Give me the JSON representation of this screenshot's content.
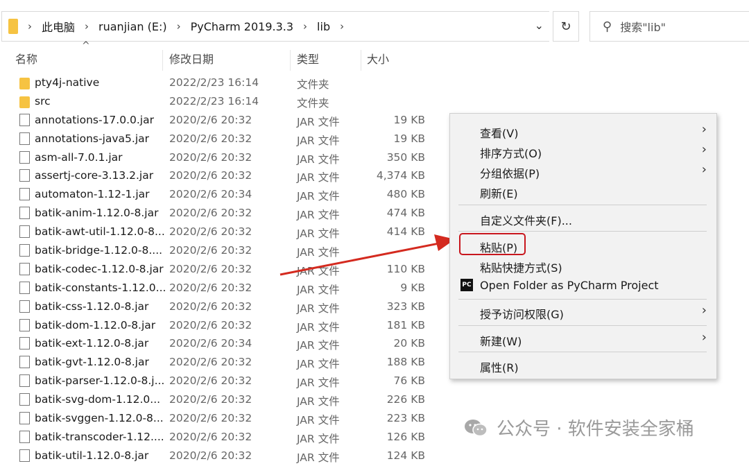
{
  "breadcrumb": [
    "此电脑",
    "ruanjian (E:)",
    "PyCharm 2019.3.3",
    "lib"
  ],
  "search": {
    "placeholder": "搜索\"lib\""
  },
  "columns": {
    "name": "名称",
    "date": "修改日期",
    "type": "类型",
    "size": "大小"
  },
  "files": [
    {
      "name": "pty4j-native",
      "date": "2022/2/23 16:14",
      "type": "文件夹",
      "size": "",
      "icon": "folder-icon"
    },
    {
      "name": "src",
      "date": "2022/2/23 16:14",
      "type": "文件夹",
      "size": "",
      "icon": "folder-icon"
    },
    {
      "name": "annotations-17.0.0.jar",
      "date": "2020/2/6 20:32",
      "type": "JAR 文件",
      "size": "19 KB",
      "icon": "file-icon"
    },
    {
      "name": "annotations-java5.jar",
      "date": "2020/2/6 20:32",
      "type": "JAR 文件",
      "size": "19 KB",
      "icon": "file-icon"
    },
    {
      "name": "asm-all-7.0.1.jar",
      "date": "2020/2/6 20:32",
      "type": "JAR 文件",
      "size": "350 KB",
      "icon": "file-icon"
    },
    {
      "name": "assertj-core-3.13.2.jar",
      "date": "2020/2/6 20:32",
      "type": "JAR 文件",
      "size": "4,374 KB",
      "icon": "file-icon"
    },
    {
      "name": "automaton-1.12-1.jar",
      "date": "2020/2/6 20:34",
      "type": "JAR 文件",
      "size": "480 KB",
      "icon": "file-icon"
    },
    {
      "name": "batik-anim-1.12.0-8.jar",
      "date": "2020/2/6 20:32",
      "type": "JAR 文件",
      "size": "474 KB",
      "icon": "file-icon"
    },
    {
      "name": "batik-awt-util-1.12.0-8...",
      "date": "2020/2/6 20:32",
      "type": "JAR 文件",
      "size": "414 KB",
      "icon": "file-icon"
    },
    {
      "name": "batik-bridge-1.12.0-8....",
      "date": "2020/2/6 20:32",
      "type": "JAR 文件",
      "size": "",
      "icon": "file-icon"
    },
    {
      "name": "batik-codec-1.12.0-8.jar",
      "date": "2020/2/6 20:32",
      "type": "JAR 文件",
      "size": "110 KB",
      "icon": "file-icon"
    },
    {
      "name": "batik-constants-1.12.0...",
      "date": "2020/2/6 20:32",
      "type": "JAR 文件",
      "size": "9 KB",
      "icon": "file-icon"
    },
    {
      "name": "batik-css-1.12.0-8.jar",
      "date": "2020/2/6 20:32",
      "type": "JAR 文件",
      "size": "323 KB",
      "icon": "file-icon"
    },
    {
      "name": "batik-dom-1.12.0-8.jar",
      "date": "2020/2/6 20:32",
      "type": "JAR 文件",
      "size": "181 KB",
      "icon": "file-icon"
    },
    {
      "name": "batik-ext-1.12.0-8.jar",
      "date": "2020/2/6 20:34",
      "type": "JAR 文件",
      "size": "20 KB",
      "icon": "file-icon"
    },
    {
      "name": "batik-gvt-1.12.0-8.jar",
      "date": "2020/2/6 20:32",
      "type": "JAR 文件",
      "size": "188 KB",
      "icon": "file-icon"
    },
    {
      "name": "batik-parser-1.12.0-8.j...",
      "date": "2020/2/6 20:32",
      "type": "JAR 文件",
      "size": "76 KB",
      "icon": "file-icon"
    },
    {
      "name": "batik-svg-dom-1.12.0...",
      "date": "2020/2/6 20:32",
      "type": "JAR 文件",
      "size": "226 KB",
      "icon": "file-icon"
    },
    {
      "name": "batik-svggen-1.12.0-8...",
      "date": "2020/2/6 20:32",
      "type": "JAR 文件",
      "size": "223 KB",
      "icon": "file-icon"
    },
    {
      "name": "batik-transcoder-1.12....",
      "date": "2020/2/6 20:32",
      "type": "JAR 文件",
      "size": "126 KB",
      "icon": "file-icon"
    },
    {
      "name": "batik-util-1.12.0-8.jar",
      "date": "2020/2/6 20:32",
      "type": "JAR 文件",
      "size": "124 KB",
      "icon": "file-icon"
    }
  ],
  "context_menu": {
    "view": "查看(V)",
    "sort": "排序方式(O)",
    "group": "分组依据(P)",
    "refresh": "刷新(E)",
    "customize": "自定义文件夹(F)...",
    "paste": "粘贴(P)",
    "paste_shortcut": "粘贴快捷方式(S)",
    "open_pycharm": "Open Folder as PyCharm Project",
    "pycharm_icon_text": "PC",
    "grant_access": "授予访问权限(G)",
    "new": "新建(W)",
    "properties": "属性(R)"
  },
  "watermark": "公众号 · 软件安装全家桶",
  "colors": {
    "arrow": "#d42a1f",
    "highlight": "#c8161d",
    "folder": "#f6c342"
  }
}
